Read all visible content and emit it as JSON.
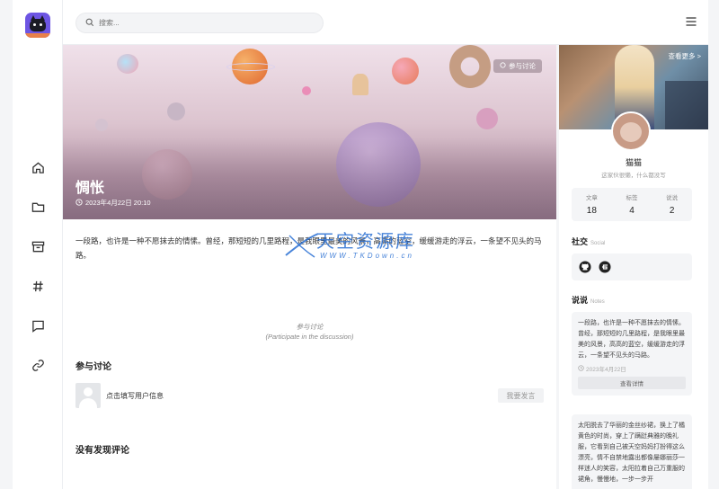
{
  "search": {
    "placeholder": "搜索..."
  },
  "post": {
    "title": "惆怅",
    "date": "2023年4月22日 20:10",
    "discuss_tag": "参与讨论",
    "content": "一段路，也许是一种不愿抹去的情愫。曾经，那短短的几里路程，是我眼里最美的风景，高高的蓝空，缓缓游走的浮云，一条望不见头的马路。"
  },
  "discussion": {
    "label_cn": "参与讨论",
    "label_en": "(Participate in the discussion)",
    "heading": "参与讨论",
    "fill_user": "点击填写用户信息",
    "reply_button": "我要发言",
    "no_comments": "没有发现评论"
  },
  "watermark": {
    "title": "天空资源库",
    "url": "WWW.TKDown.cn"
  },
  "profile": {
    "see_more": "查看更多 >",
    "name": "猫猫",
    "bio": "这家伙很懒，什么都没写",
    "stats": [
      {
        "label": "文章",
        "value": "18"
      },
      {
        "label": "标签",
        "value": "4"
      },
      {
        "label": "说说",
        "value": "2"
      }
    ]
  },
  "social": {
    "title": "社交",
    "subtitle": "Social",
    "icons": [
      "github-icon",
      "gitee-icon"
    ]
  },
  "notes": {
    "title": "说说",
    "subtitle": "Notes",
    "items": [
      {
        "text": "一段路，也许是一种不愿抹去的情愫。曾经，那短短的几里路程，是我眼里最美的风景，高高的蓝空，缓缓游走的浮云，一条望不见头的马路。",
        "date": "2023年4月22日",
        "detail": "查看详情"
      },
      {
        "text": "太阳脱去了华丽的金丝纱裙，换上了橘黄色的时尚，穿上了蹒跹典雅的晚礼服，它看到自己被天空妈妈打扮得这么漂亮，情不自禁地露出都像屡娜丽莎一样迷人的笑容，太阳拉着自己万重服的裙角，慢慢地，一步一步开",
        "date": "",
        "detail": ""
      }
    ]
  },
  "nav_icons": [
    "home-icon",
    "folder-icon",
    "archive-icon",
    "hash-icon",
    "message-icon",
    "link-icon"
  ]
}
